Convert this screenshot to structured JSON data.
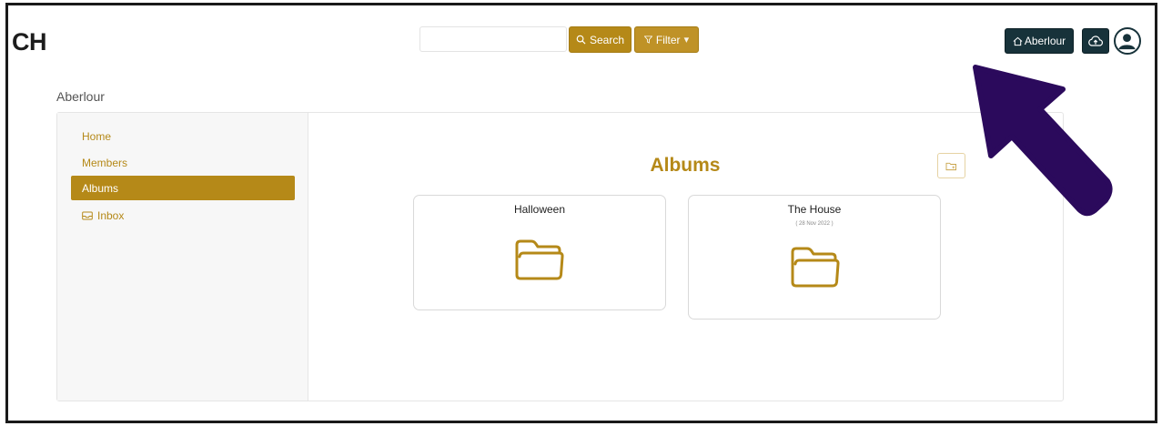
{
  "header": {
    "logo_text": "CH",
    "search": {
      "placeholder": "",
      "value": "",
      "button_label": "Search"
    },
    "filter_label": "Filter",
    "home_button_label": "Aberlour",
    "upload_icon": "cloud-upload-icon",
    "user_icon": "user-circle-icon"
  },
  "breadcrumb": "Aberlour",
  "sidebar": {
    "items": [
      {
        "label": "Home",
        "active": false
      },
      {
        "label": "Members",
        "active": false
      },
      {
        "label": "Albums",
        "active": true
      },
      {
        "label": "Inbox",
        "active": false,
        "icon": "inbox-icon"
      }
    ]
  },
  "main": {
    "title": "Albums",
    "new_folder_icon": "folder-plus-icon",
    "albums": [
      {
        "name": "Halloween",
        "date": ""
      },
      {
        "name": "The House",
        "date": "( 28 Nov 2022 )"
      }
    ]
  },
  "colors": {
    "accent": "#b58918",
    "dark": "#17323a",
    "annotation": "#2b0a5c"
  }
}
